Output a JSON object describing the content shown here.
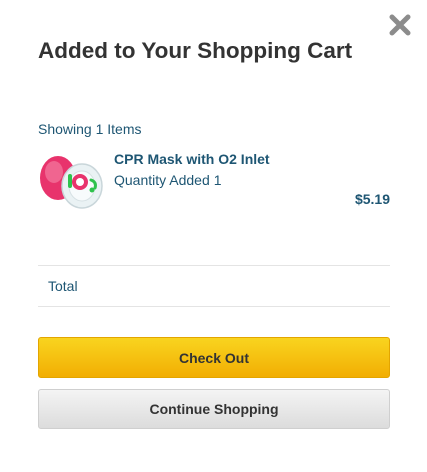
{
  "modal": {
    "title": "Added to Your Shopping Cart",
    "close_icon": "close-icon"
  },
  "cart": {
    "showing_text": "Showing 1 Items",
    "items": [
      {
        "name": "CPR Mask with O2 Inlet",
        "quantity_label": "Quantity Added",
        "quantity": "1",
        "price": "$5.19",
        "thumbnail_icon": "cpr-mask-product-image"
      }
    ],
    "total_label": "Total"
  },
  "actions": {
    "checkout_label": "Check Out",
    "continue_label": "Continue Shopping"
  },
  "colors": {
    "text_blue": "#1e5673",
    "title_gray": "#333333",
    "checkout_top": "#f9d41f",
    "checkout_bottom": "#f2ae03",
    "continue_top": "#f4f4f4",
    "continue_bottom": "#dcdcdc",
    "close_gray": "#8c8c8c"
  }
}
